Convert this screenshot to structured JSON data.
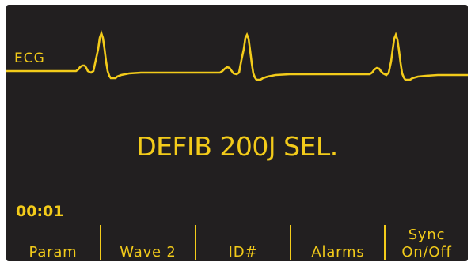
{
  "monitor": {
    "lead_label": "ECG",
    "message": "DEFIB 200J SEL.",
    "elapsed_time": "00:01",
    "trace_color": "#f3cb1a",
    "background_color": "#221f20"
  },
  "softkeys": [
    {
      "lines": [
        "Param"
      ]
    },
    {
      "lines": [
        "Wave 2"
      ]
    },
    {
      "lines": [
        "ID#"
      ]
    },
    {
      "lines": [
        "Alarms"
      ]
    },
    {
      "lines": [
        "Sync",
        "On/Off"
      ]
    }
  ]
}
